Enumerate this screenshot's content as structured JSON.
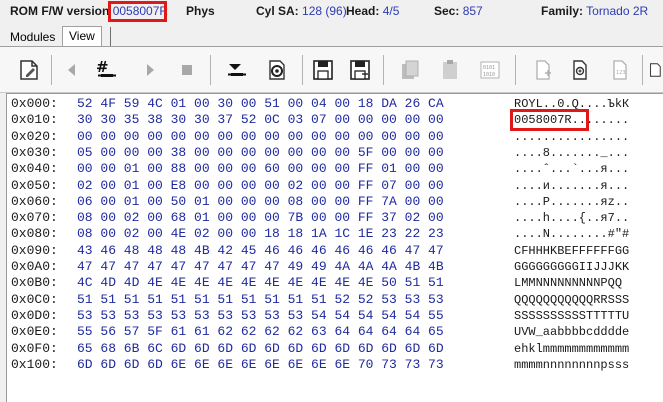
{
  "info_bar": {
    "rom_label": "ROM F/W version",
    "rom_value": "0058007R",
    "phys_label": "Phys",
    "cylsa_label": "Cyl SA:",
    "cylsa_value": "128 (96)",
    "head_label": "Head:",
    "head_value": "4/5",
    "sec_label": "Sec:",
    "sec_value": "857",
    "family_label": "Family:",
    "family_value": "Tornado 2R"
  },
  "tabs": [
    {
      "label": "Modules",
      "active": false
    },
    {
      "label": "View",
      "active": true
    }
  ],
  "toolbar": {
    "icons": [
      "edit-icon",
      "arrow-left-icon",
      "hash-icon",
      "arrow-right-icon",
      "stop-icon",
      "download-icon",
      "gear-refresh-icon",
      "save-icon",
      "save-as-icon",
      "copy-icon",
      "paste-icon",
      "hex-convert-icon",
      "new-doc-icon",
      "add-doc-icon",
      "numbered-doc-icon",
      "doc-icon"
    ]
  },
  "hex_rows": [
    {
      "offset": "0x000:",
      "hex": "52 4F 59 4C 01 00 30 00 51 00 04 00 18 DA 26 CA",
      "ascii": "ROYL..0.Q....ЪkК"
    },
    {
      "offset": "0x010:",
      "hex": "30 30 35 38 30 30 37 52 0C 03 07 00 00 00 00 00",
      "ascii": "0058007R........"
    },
    {
      "offset": "0x020:",
      "hex": "00 00 00 00 00 00 00 00 00 00 00 00 00 00 00 00",
      "ascii": "................"
    },
    {
      "offset": "0x030:",
      "hex": "05 00 00 00 38 00 00 00 00 00 00 00 5F 00 00 00",
      "ascii": "....8......._..."
    },
    {
      "offset": "0x040:",
      "hex": "00 00 01 00 88 00 00 00 60 00 00 00 FF 01 00 00",
      "ascii": "....ˆ...`...я..."
    },
    {
      "offset": "0x050:",
      "hex": "02 00 01 00 E8 00 00 00 00 02 00 00 FF 07 00 00",
      "ascii": "....и.......я..."
    },
    {
      "offset": "0x060:",
      "hex": "06 00 01 00 50 01 00 00 00 08 00 00 FF 7A 00 00",
      "ascii": "....P.......яz.."
    },
    {
      "offset": "0x070:",
      "hex": "08 00 02 00 68 01 00 00 00 7B 00 00 FF 37 02 00",
      "ascii": "....h....{..я7.."
    },
    {
      "offset": "0x080:",
      "hex": "08 00 02 00 4E 02 00 00 18 18 1A 1C 1E 23 22 23",
      "ascii": "....N........#\"#"
    },
    {
      "offset": "0x090:",
      "hex": "43 46 48 48 48 4B 42 45 46 46 46 46 46 46 47 47",
      "ascii": "CFHHHKBEFFFFFFGG"
    },
    {
      "offset": "0x0A0:",
      "hex": "47 47 47 47 47 47 47 47 47 49 49 4A 4A 4A 4B 4B",
      "ascii": "GGGGGGGGGIIJJJKK"
    },
    {
      "offset": "0x0B0:",
      "hex": "4C 4D 4D 4E 4E 4E 4E 4E 4E 4E 4E 4E 4E 50 51 51",
      "ascii": "LMMNNNNNNNNNPQQ"
    },
    {
      "offset": "0x0C0:",
      "hex": "51 51 51 51 51 51 51 51 51 51 51 52 52 53 53 53",
      "ascii": "QQQQQQQQQQQRRSSS"
    },
    {
      "offset": "0x0D0:",
      "hex": "53 53 53 53 53 53 53 53 53 53 54 54 54 54 54 55",
      "ascii": "SSSSSSSSSSTTTTTU"
    },
    {
      "offset": "0x0E0:",
      "hex": "55 56 57 5F 61 61 62 62 62 62 63 64 64 64 64 65",
      "ascii": "UVW_aabbbbcdddde"
    },
    {
      "offset": "0x0F0:",
      "hex": "65 68 6B 6C 6D 6D 6D 6D 6D 6D 6D 6D 6D 6D 6D 6D",
      "ascii": "ehklmmmmmmmmmmmm"
    },
    {
      "offset": "0x100:",
      "hex": "6D 6D 6D 6D 6E 6E 6E 6E 6E 6E 6E 6E 70 73 73 73",
      "ascii": "mmmmnnnnnnnnpsss"
    }
  ],
  "colors": {
    "highlight": "#e01818",
    "hex_text": "#1f2a9e",
    "value_text": "#2d3bb0"
  }
}
